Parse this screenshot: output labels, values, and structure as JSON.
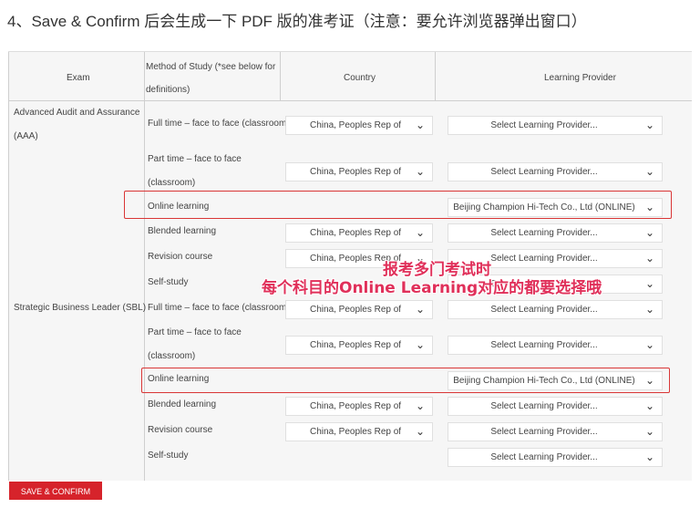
{
  "heading": "4、Save & Confirm 后会生成一下 PDF 版的准考证（注意：要允许浏览器弹出窗口）",
  "table": {
    "headers": {
      "exam": "Exam",
      "method_line1": "Method of Study (*see below for",
      "method_line2": "definitions)",
      "country": "Country",
      "provider": "Learning Provider"
    },
    "exams": [
      {
        "line1": "Advanced Audit and Assurance",
        "line2": "(AAA)"
      },
      {
        "line1": "Strategic Business Leader (SBL)",
        "line2": ""
      }
    ],
    "rows": [
      {
        "method": "Full time – face to face (classroom)",
        "method2": "",
        "country": "China, Peoples Rep of",
        "provider": "Select Learning Provider..."
      },
      {
        "method": "Part time – face to face",
        "method2": "(classroom)",
        "country": "China, Peoples Rep of",
        "provider": "Select Learning Provider..."
      },
      {
        "method": "Online learning",
        "method2": "",
        "country": "",
        "provider": "Beijing Champion Hi-Tech Co., Ltd (ONLINE)"
      },
      {
        "method": "Blended learning",
        "method2": "",
        "country": "China, Peoples Rep of",
        "provider": "Select Learning Provider..."
      },
      {
        "method": "Revision course",
        "method2": "",
        "country": "China, Peoples Rep of",
        "provider": "Select Learning Provider..."
      },
      {
        "method": "Self-study",
        "method2": "",
        "country": "",
        "provider": "Select Learning Provider..."
      },
      {
        "method": "Full time – face to face (classroom)",
        "method2": "",
        "country": "China, Peoples Rep of",
        "provider": "Select Learning Provider..."
      },
      {
        "method": "Part time – face to face",
        "method2": "(classroom)",
        "country": "China, Peoples Rep of",
        "provider": "Select Learning Provider..."
      },
      {
        "method": "Online learning",
        "method2": "",
        "country": "",
        "provider": "Beijing Champion Hi-Tech Co., Ltd (ONLINE)"
      },
      {
        "method": "Blended learning",
        "method2": "",
        "country": "China, Peoples Rep of",
        "provider": "Select Learning Provider..."
      },
      {
        "method": "Revision course",
        "method2": "",
        "country": "China, Peoples Rep of",
        "provider": "Select Learning Provider..."
      },
      {
        "method": "Self-study",
        "method2": "",
        "country": "",
        "provider": "Select Learning Provider..."
      }
    ]
  },
  "annotation": {
    "line1": "报考多门考试时",
    "line2": "每个科目的Online Learning对应的都要选择哦",
    "color": "#e0305a"
  },
  "button": {
    "label": "SAVE & CONFIRM",
    "color": "#d6232b"
  }
}
